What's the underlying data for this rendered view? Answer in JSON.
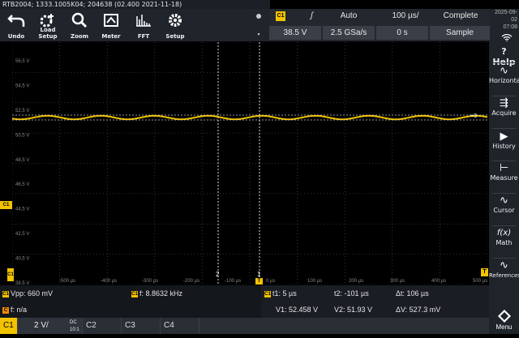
{
  "title_bar": "RTB2004; 1333.1005K04; 204638 (02.400 2021-11-18)",
  "toolbar": [
    {
      "label": "Undo",
      "icon": "undo-icon"
    },
    {
      "label": "Load Setup",
      "icon": "load-setup-icon"
    },
    {
      "label": "Zoom",
      "icon": "zoom-icon"
    },
    {
      "label": "Meter",
      "icon": "meter-icon"
    },
    {
      "label": "FFT",
      "icon": "fft-icon"
    },
    {
      "label": "Setup",
      "icon": "setup-icon"
    }
  ],
  "trigger": {
    "source": "C1",
    "slope_symbol": "ʃ",
    "mode": "Auto",
    "timebase": "100 µs/",
    "acq_state": "Complete",
    "level": "38.5 V",
    "sample_rate": "2.5 GSa/s",
    "position": "0 s",
    "acq_mode": "Sample"
  },
  "date": {
    "date": "2025-09-02",
    "time": "07:08"
  },
  "side_menu": [
    {
      "label": "Help",
      "icon": "help-icon",
      "glyph": "?"
    },
    {
      "label": "Horizontal",
      "icon": "horizontal-icon",
      "glyph": "∿"
    },
    {
      "label": "Acquire",
      "icon": "acquire-icon",
      "glyph": "⇶"
    },
    {
      "label": "History",
      "icon": "history-icon",
      "glyph": "▶"
    },
    {
      "label": "Measure",
      "icon": "measure-icon",
      "glyph": "⊢"
    },
    {
      "label": "Cursor",
      "icon": "cursor-icon",
      "glyph": "∿"
    },
    {
      "label": "Math",
      "icon": "math-icon",
      "glyph": "f(x)"
    },
    {
      "label": "References",
      "icon": "references-icon",
      "glyph": "∿"
    }
  ],
  "menu_label": "Menu",
  "colors": {
    "ch1": "#f2c300",
    "ch_orange": "#f08a00",
    "grid": "#5a5a5a",
    "cursor": "#ffffff"
  },
  "y_labels": [
    "56,5 V",
    "54,5 V",
    "52,5 V",
    "50,5 V",
    "48,5 V",
    "46,5 V",
    "44,5 V",
    "42,5 V",
    "40,5 V",
    "38,5 V"
  ],
  "x_labels": [
    "-500 µs",
    "-400 µs",
    "-300 µs",
    "-200 µs",
    "-100 µs",
    "0 µs",
    "100 µs",
    "200 µs",
    "300 µs",
    "400 µs",
    "500 µs"
  ],
  "markers": {
    "ch_left": "C1",
    "cursor1": "1",
    "cursor2": "2",
    "right_t": "T",
    "right_c": "C1"
  },
  "measurements": {
    "vpp": "Vpp: 660 mV",
    "freq": "f: 8.8632 kHz",
    "f2": "f: n/a",
    "t1": "t1: 5 µs",
    "t2": "t2: -101 µs",
    "dt": "Δt: 106 µs",
    "v1": "V1: 52.458 V",
    "v2": "V2: 51.93 V",
    "dv": "ΔV: 527.3 mV"
  },
  "channels": {
    "c1": "C1",
    "c1_scale": "2 V/",
    "c1_coupling": "DC",
    "c1_probe": "10:1",
    "c2": "C2",
    "c3": "C3",
    "c4": "C4"
  }
}
